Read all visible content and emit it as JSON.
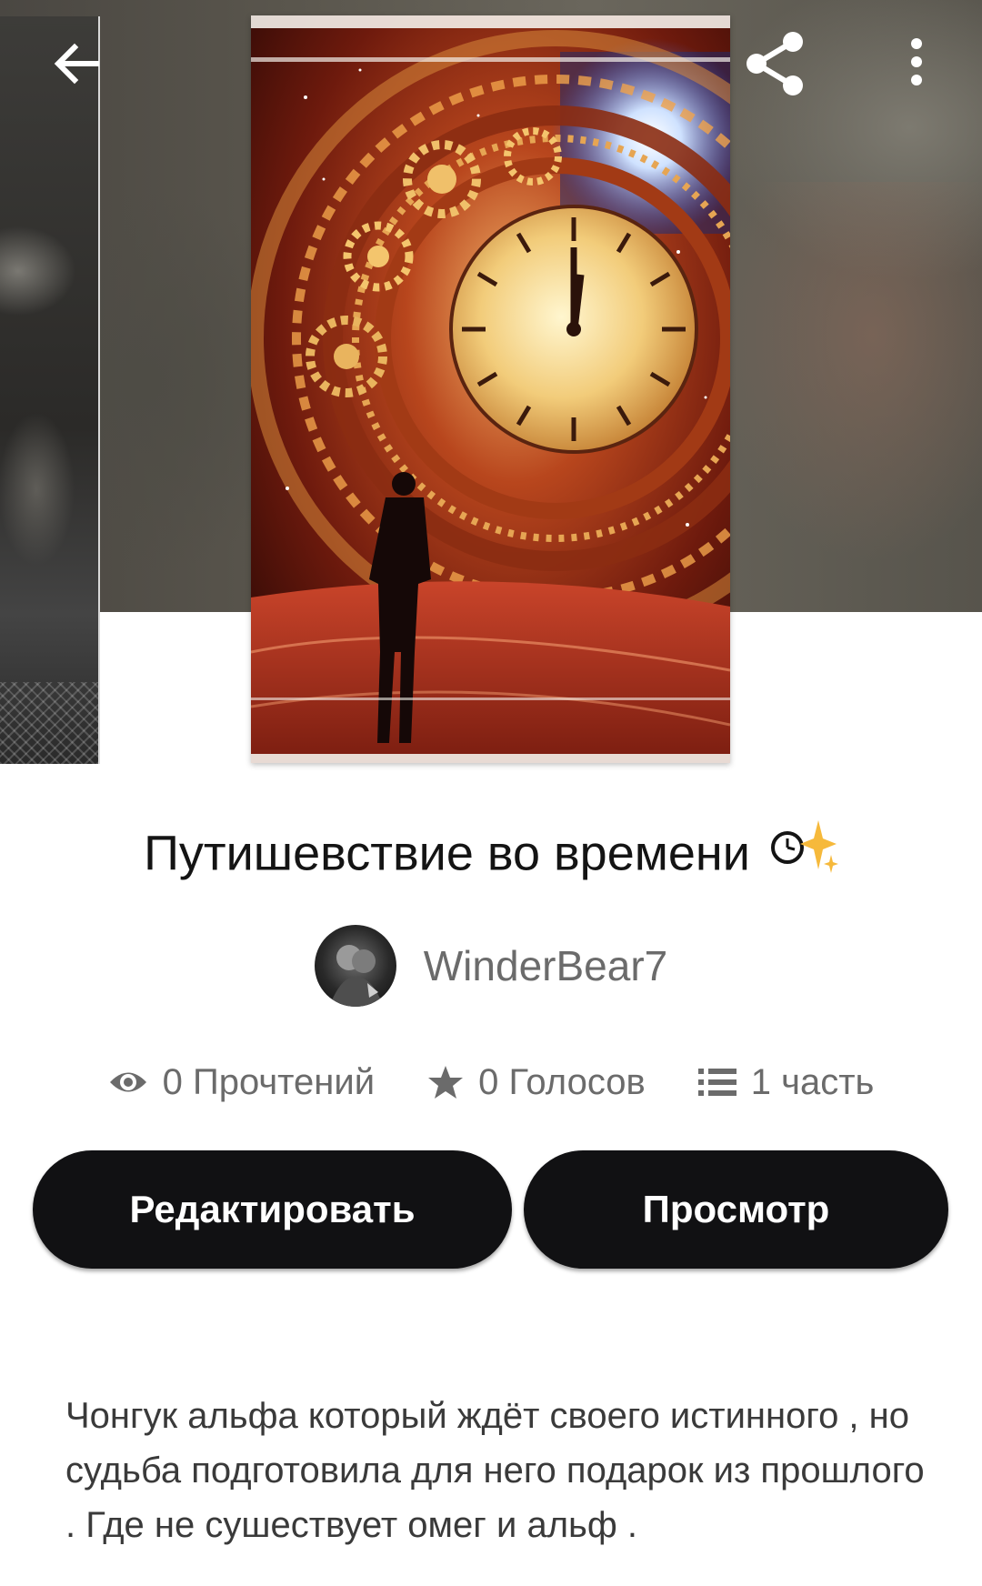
{
  "toolbar": {
    "back_icon": "arrow-left-icon",
    "share_icon": "share-icon",
    "more_icon": "more-vertical-icon"
  },
  "story": {
    "title": "Путишевствие во времени ⏲️✨",
    "title_text": "Путишевствие во времени",
    "title_emoji": "⏲️✨",
    "author": "WinderBear7",
    "description": "Чонгук альфа который ждёт своего истинного , но судьба подготовила для него подарок из прошлого . Где не сушествует омег и альф ."
  },
  "stats": {
    "reads": "0 Прочтений",
    "votes": "0 Голосов",
    "parts": "1 часть"
  },
  "actions": {
    "edit_label": "Редактировать",
    "view_label": "Просмотр"
  },
  "colors": {
    "button_bg": "#111113",
    "button_text": "#ffffff",
    "title": "#141414",
    "muted_text": "#6b6b6b"
  }
}
